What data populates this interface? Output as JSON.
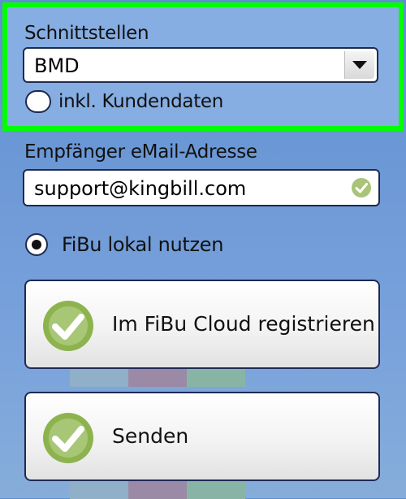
{
  "interfaces": {
    "label": "Schnittstellen",
    "selected": "BMD",
    "include_customer_data_label": "inkl. Kundendaten",
    "include_customer_data_checked": false
  },
  "recipient": {
    "label": "Empfänger eMail-Adresse",
    "value": "support@kingbill.com",
    "valid_icon": "check-circle-icon"
  },
  "fibu_local": {
    "label": "FiBu lokal nutzen",
    "selected": true
  },
  "buttons": {
    "register_label": "Im FiBu Cloud registrieren",
    "send_label": "Senden"
  },
  "colors": {
    "highlight": "#00ff00",
    "check_green": "#8db34e",
    "strip_blue": "#8fb0c8",
    "strip_red": "#9a8aa6",
    "strip_green": "#88b4a6"
  }
}
